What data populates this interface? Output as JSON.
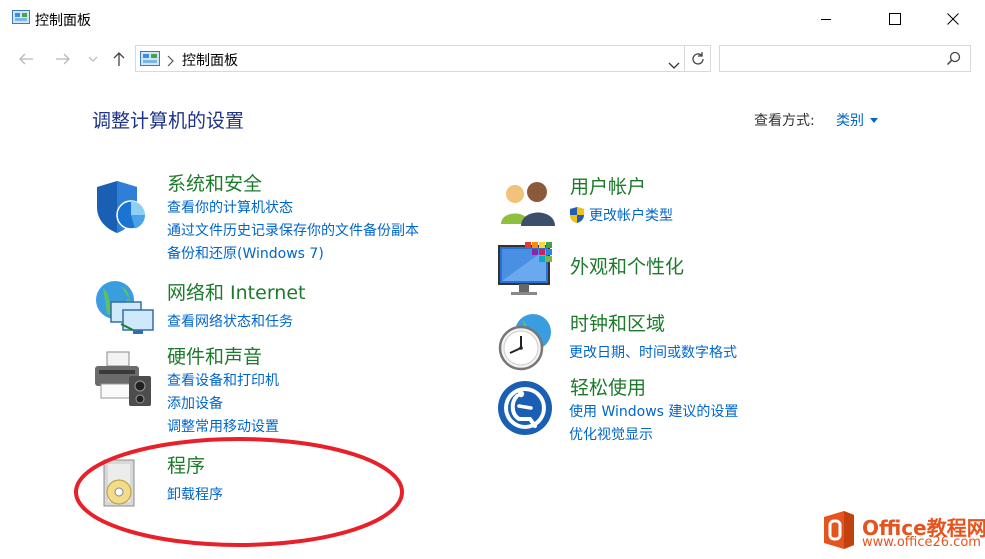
{
  "window": {
    "title": "控制面板"
  },
  "address": {
    "crumb": "控制面板"
  },
  "search": {
    "placeholder": ""
  },
  "header": {
    "title": "调整计算机的设置",
    "viewby_label": "查看方式:",
    "viewby_value": "类别"
  },
  "categories": {
    "system": {
      "title": "系统和安全",
      "links": [
        "查看你的计算机状态",
        "通过文件历史记录保存你的文件备份副本",
        "备份和还原(Windows 7)"
      ]
    },
    "network": {
      "title": "网络和 Internet",
      "links": [
        "查看网络状态和任务"
      ]
    },
    "hardware": {
      "title": "硬件和声音",
      "links": [
        "查看设备和打印机",
        "添加设备",
        "调整常用移动设置"
      ]
    },
    "programs": {
      "title": "程序",
      "links": [
        "卸载程序"
      ]
    },
    "users": {
      "title": "用户帐户",
      "links": [
        "更改帐户类型"
      ]
    },
    "appearance": {
      "title": "外观和个性化",
      "links": []
    },
    "clock": {
      "title": "时钟和区域",
      "links": [
        "更改日期、时间或数字格式"
      ]
    },
    "ease": {
      "title": "轻松使用",
      "links": [
        "使用 Windows 建议的设置",
        "优化视觉显示"
      ]
    }
  },
  "annotation": {
    "color": "#e8202a"
  },
  "watermark": {
    "line1": "Office教程网",
    "line2": "www.office26.com"
  },
  "colors": {
    "heading": "#1e3287",
    "category": "#1e7a2b",
    "link": "#0066cc"
  }
}
